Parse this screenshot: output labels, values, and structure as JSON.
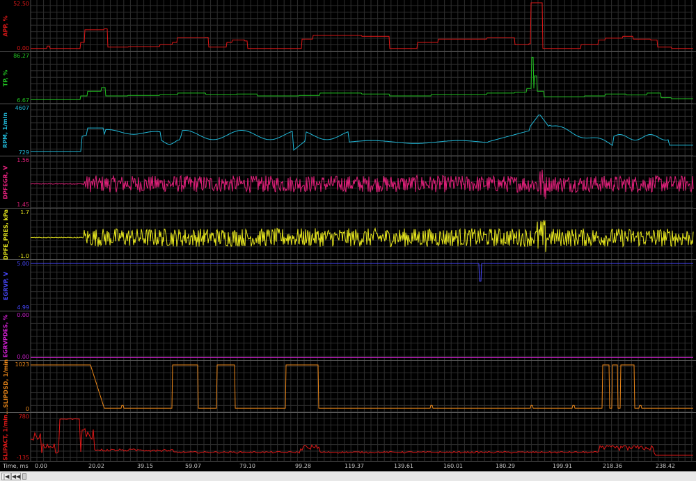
{
  "channels": [
    {
      "name": "APP, %",
      "max": "52.50",
      "min": "0.00",
      "color": "#e01818",
      "id": "app"
    },
    {
      "name": "TP, %",
      "max": "86.27",
      "min": "6.67",
      "color": "#22c422",
      "id": "tp"
    },
    {
      "name": "RPM, 1/min",
      "max": "4607",
      "min": "729",
      "color": "#20b8d8",
      "id": "rpm"
    },
    {
      "name": "DPFEGR, V",
      "max": "1.56",
      "min": "1.45",
      "color": "#e0207a",
      "id": "dpfegr"
    },
    {
      "name": "DPFE_PRES, kPa",
      "max": "1.7",
      "min": "-1.0",
      "color": "#e8e81e",
      "id": "dpfe"
    },
    {
      "name": "EGRVP, V",
      "max": "5.00",
      "min": "4.99",
      "color": "#4848ff",
      "id": "egrvp"
    },
    {
      "name": "EGRVPDES, %",
      "max": "0.00",
      "min": "0.00",
      "color": "#d020d0",
      "id": "egrvpdes"
    },
    {
      "name": "...SLIPDSD, 1/min",
      "max": "1023",
      "min": "0",
      "color": "#f08a1a",
      "id": "slipdsd"
    },
    {
      "name": "SLIPACT, 1/min",
      "max": "780",
      "min": "-135",
      "color": "#e01818",
      "id": "slipact"
    }
  ],
  "x_axis": {
    "title": "Time, ms",
    "ticks": [
      "0.00",
      "20.02",
      "39.15",
      "59.07",
      "79.10",
      "99.28",
      "119.37",
      "139.61",
      "160.01",
      "180.29",
      "199.91",
      "218.36",
      "238.42"
    ]
  },
  "scrollbar": {
    "first_label": "|◀",
    "prev_label": "◀◀"
  },
  "colors": {
    "background": "#000000",
    "grid": "#2e2e2e",
    "grid_major": "#3a3a3a"
  }
}
